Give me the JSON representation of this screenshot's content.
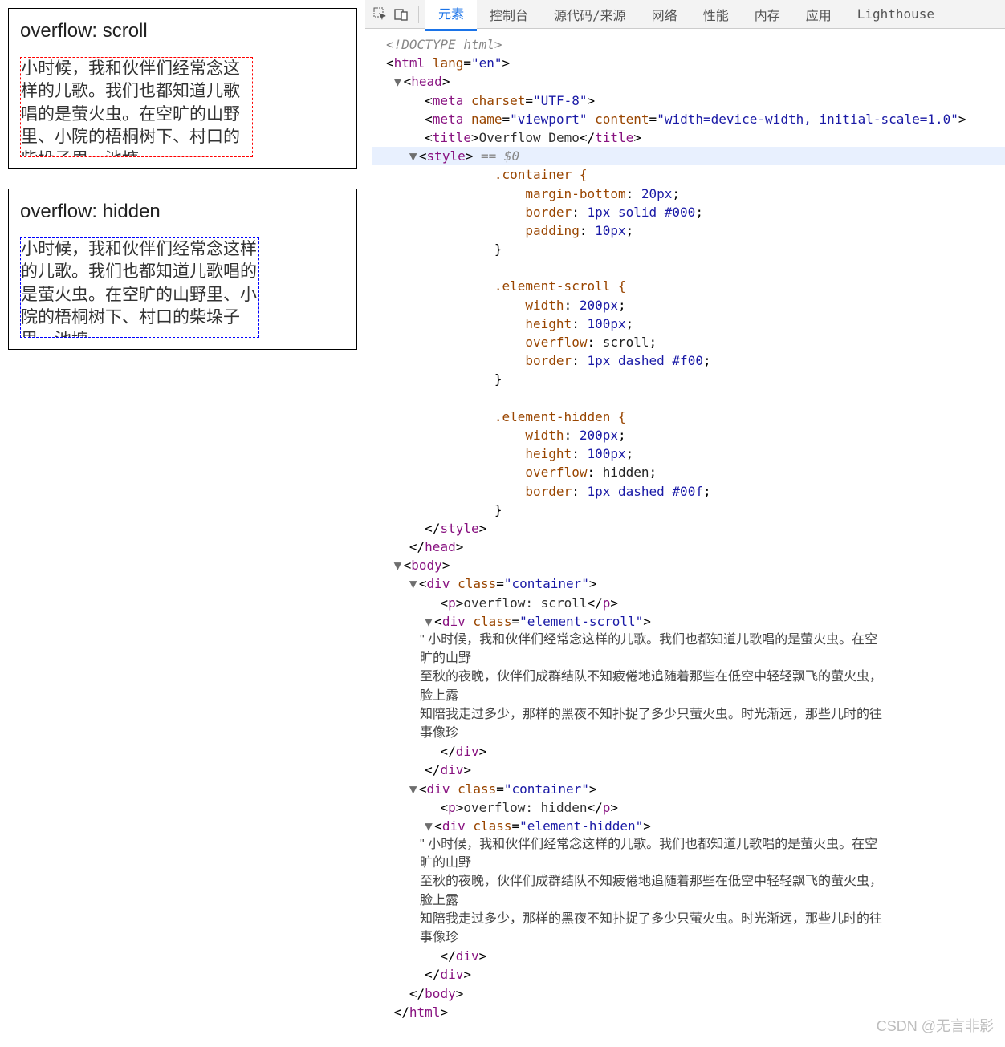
{
  "left": {
    "scroll_label": "overflow: scroll",
    "hidden_label": "overflow: hidden",
    "sample_text": "小时候，我和伙伴们经常念这样的儿歌。我们也都知道儿歌唱的是萤火虫。在空旷的山野里、小院的梧桐树下、村口的柴垛子里、池塘"
  },
  "tabs": {
    "elements": "元素",
    "console": "控制台",
    "sources": "源代码/来源",
    "network": "网络",
    "performance": "性能",
    "memory": "内存",
    "application": "应用",
    "lighthouse": "Lighthouse"
  },
  "dom": {
    "doctype": "<!DOCTYPE html>",
    "html_open": "html",
    "lang_attr": "lang",
    "lang_val": "\"en\"",
    "head": "head",
    "meta1_attr": "charset",
    "meta1_val": "\"UTF-8\"",
    "meta2_name": "name",
    "meta2_name_val": "\"viewport\"",
    "meta2_content": "content",
    "meta2_content_val": "\"width=device-width, initial-scale=1.0\"",
    "title_tag": "title",
    "title_text": "Overflow Demo",
    "style_tag": "style",
    "eq0": " == $0",
    "css_container_sel": ".container {",
    "css_mb": "margin-bottom",
    "css_mb_val": "20px",
    "css_border": "border",
    "css_border_val1": "1px solid ",
    "css_border_hex1": "#000",
    "css_padding": "padding",
    "css_padding_val": "10px",
    "css_scroll_sel": ".element-scroll {",
    "css_width": "width",
    "css_width_val": "200px",
    "css_height": "height",
    "css_height_val": "100px",
    "css_overflow": "overflow",
    "css_overflow_scroll": "scroll",
    "css_border_dashed": "1px dashed ",
    "css_border_hex_red": "#f00",
    "css_hidden_sel": ".element-hidden {",
    "css_overflow_hidden": "hidden",
    "css_border_hex_blue": "#00f",
    "body": "body",
    "div": "div",
    "class_attr": "class",
    "class_container": "\"container\"",
    "class_scroll": "\"element-scroll\"",
    "class_hidden": "\"element-hidden\"",
    "p_scroll_text": "overflow: scroll",
    "p_hidden_text": "overflow: hidden",
    "long_text_1": "\" 小时候，我和伙伴们经常念这样的儿歌。我们也都知道儿歌唱的是萤火虫。在空旷的山野",
    "long_text_2": "至秋的夜晚，伙伴们成群结队不知疲倦地追随着那些在低空中轻轻飘飞的萤火虫，脸上露",
    "long_text_3": "知陪我走过多少，那样的黑夜不知扑捉了多少只萤火虫。时光渐远，那些儿时的往事像珍"
  },
  "watermark": "CSDN @无言非影"
}
